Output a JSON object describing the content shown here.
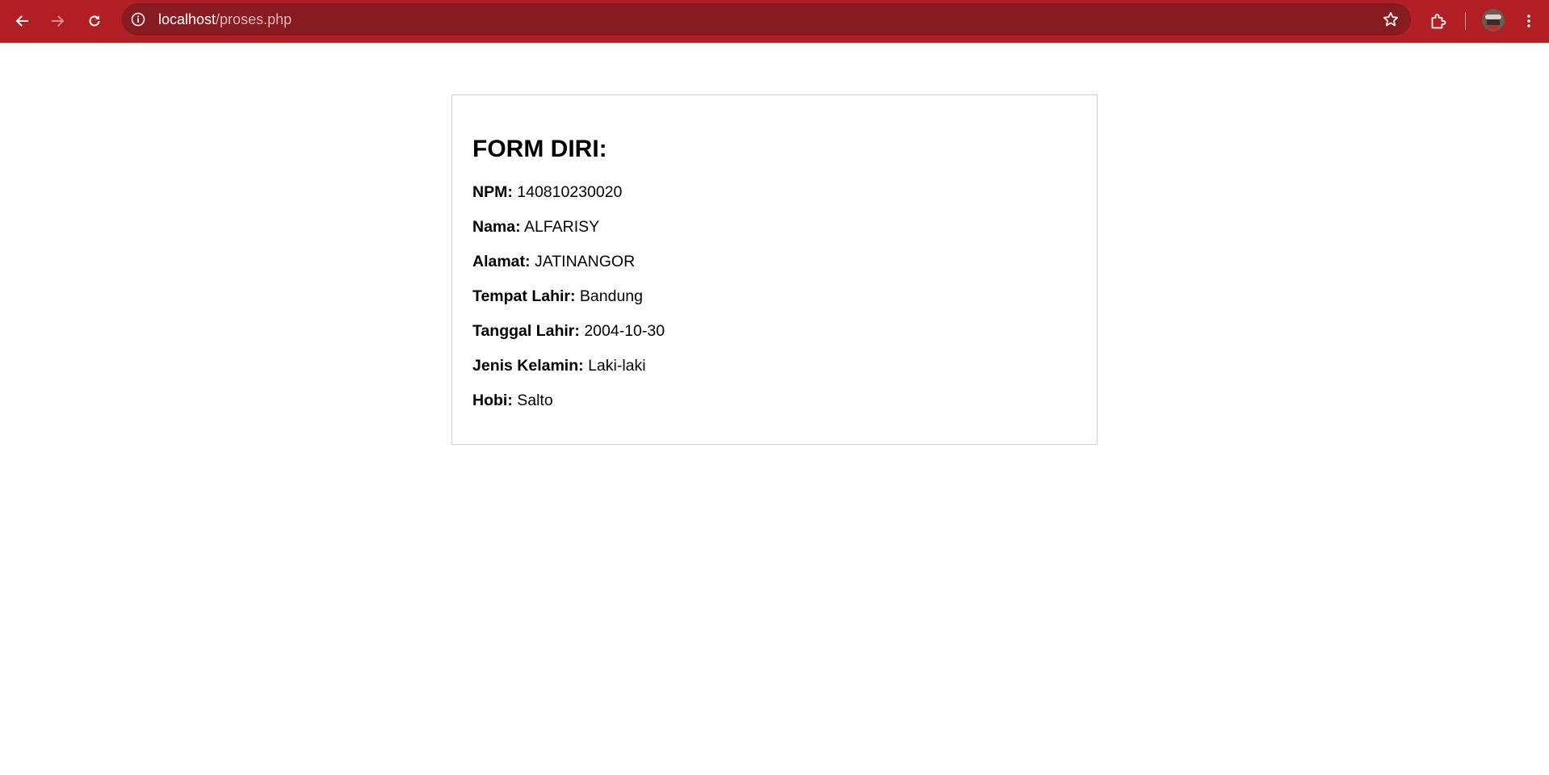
{
  "browser": {
    "url_host": "localhost",
    "url_path": "/proses.php",
    "colors": {
      "toolbar": "#b11e23",
      "omnibox": "#871b1f"
    },
    "icons": [
      "back-arrow-icon",
      "forward-arrow-icon",
      "reload-icon",
      "site-info-icon",
      "bookmark-star-icon",
      "extensions-icon",
      "profile-avatar",
      "more-menu-icon"
    ]
  },
  "form": {
    "title": "FORM DIRI:",
    "fields": [
      {
        "label": "NPM:",
        "value": "140810230020"
      },
      {
        "label": "Nama:",
        "value": "ALFARISY"
      },
      {
        "label": "Alamat:",
        "value": "JATINANGOR"
      },
      {
        "label": "Tempat Lahir:",
        "value": "Bandung"
      },
      {
        "label": "Tanggal Lahir:",
        "value": "2004-10-30"
      },
      {
        "label": "Jenis Kelamin:",
        "value": "Laki-laki"
      },
      {
        "label": "Hobi:",
        "value": "Salto"
      }
    ]
  }
}
